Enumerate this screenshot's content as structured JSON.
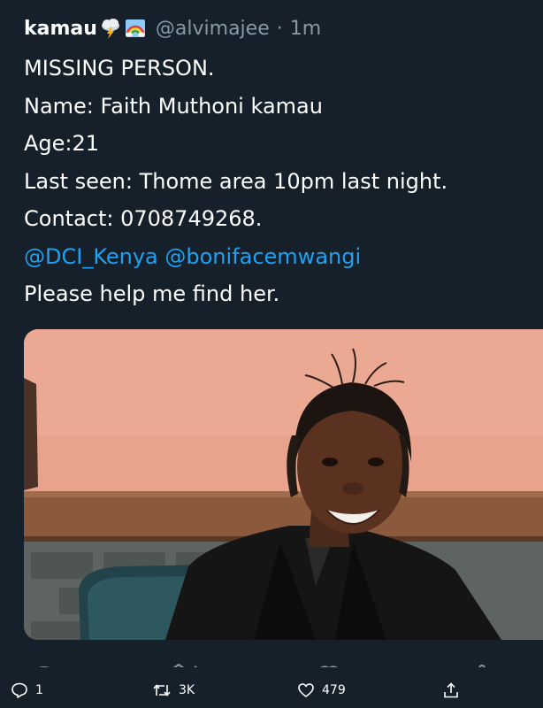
{
  "tweet": {
    "author": {
      "display_name": "kamau",
      "emoji": [
        "cloud-lightning-icon",
        "rainbow-icon"
      ],
      "handle": "@alvimajee",
      "separator": "·",
      "time": "1m"
    },
    "lines": {
      "l1": "MISSING PERSON.",
      "l2": "Name: Faith Muthoni kamau",
      "l3": "Age:21",
      "l4": "Last seen: Thome area 10pm last night.",
      "l5": "Contact: 0708749268.",
      "mention1": "@DCI_Kenya",
      "mention2": "@bonifacemwangi",
      "l7": "Please help me find her."
    },
    "media": {
      "type": "photo",
      "icon": "person-photo"
    }
  },
  "actions": {
    "reply": {
      "icon": "reply-icon",
      "count": "1"
    },
    "retweet": {
      "icon": "retweet-icon",
      "count": "3K"
    },
    "like": {
      "icon": "heart-icon",
      "count": "479"
    },
    "share": {
      "icon": "share-icon"
    }
  },
  "colors": {
    "background": "#15202b",
    "text": "#ffffff",
    "secondary": "#8899a6",
    "link": "#1da1f2"
  }
}
